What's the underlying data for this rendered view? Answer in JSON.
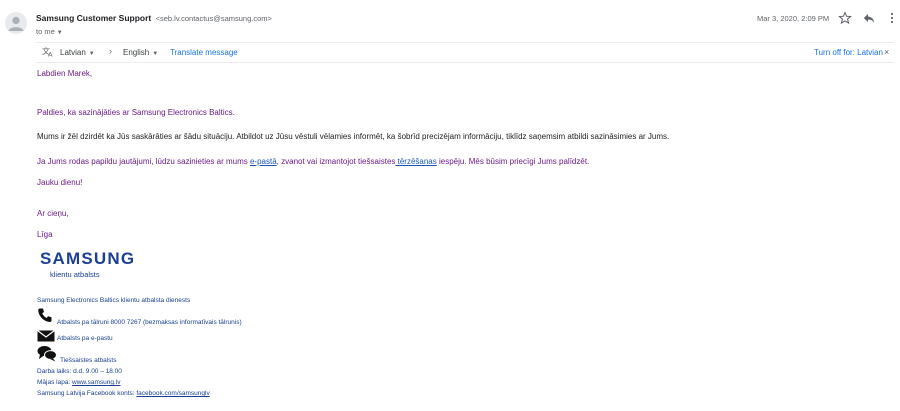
{
  "header": {
    "sender_name": "Samsung Customer Support",
    "sender_email": "<seb.lv.contactus@samsung.com>",
    "to_label": "to me",
    "date": "Mar 3, 2020, 2:09 PM"
  },
  "translate": {
    "from_lang": "Latvian",
    "to_lang": "English",
    "translate_label": "Translate message",
    "turn_off_label": "Turn off for: Latvian"
  },
  "email": {
    "greeting": "Labdien Marek,",
    "para1": "Paldies, ka sazinājāties ar Samsung Electronics Baltics.",
    "para2": "Mums ir žēl dzirdēt ka Jūs saskārāties ar šādu situāciju. Atbildot uz Jūsu vēstuli vēlamies informēt, ka šobrīd precizējam informāciju, tiklīdz saņemsim atbildi sazināsimies ar Jums.",
    "para3_a": "Ja Jums rodas papildu jautājumi, lūdzu sazinieties ar mums ",
    "para3_link1": "e-pastā",
    "para3_b": ", zvanot vai izmantojot tiešsaistes",
    "para3_link2": " tērzēšanas",
    "para3_c": " iespēju. Mēs būsim  priecīgi Jums palīdzēt.",
    "closing": "Jauku dienu!",
    "regards": "Ar cieņu,",
    "signer": "Līga"
  },
  "signature": {
    "logo_text": "SAMSUNG",
    "logo_sub": "klientu atbalsts",
    "dept": "Samsung Electronics Baltics klientu atbalsta dienests",
    "phone": "Atbalsts pa tālruni 8000 7267 (bezmaksas informatīvais tālrunis)",
    "email_support": "Atbalsts pa e-pastu",
    "chat": "Tiešsaistes atbalsts",
    "hours": "Darba laiks: d.d. 9.00 – 18.00",
    "home_label": "Mājas lapa: ",
    "home_link": "www.samsung.lv",
    "fb_label": "Samsung Latvija Facebook konts: ",
    "fb_link": "facebook.com/samsunglv"
  },
  "icons": {
    "avatar": "person-avatar-icon",
    "star": "star-icon",
    "reply": "reply-icon",
    "more": "more-vert-icon",
    "translate": "translate-icon",
    "arrow": "chevron-right-icon",
    "close": "close-icon",
    "phone": "phone-icon",
    "envelope": "envelope-icon",
    "chat": "chat-bubbles-icon"
  },
  "colors": {
    "purple_text": "#6b1d8a",
    "samsung_blue": "#1a3f94",
    "link_blue": "#1a73e8"
  }
}
